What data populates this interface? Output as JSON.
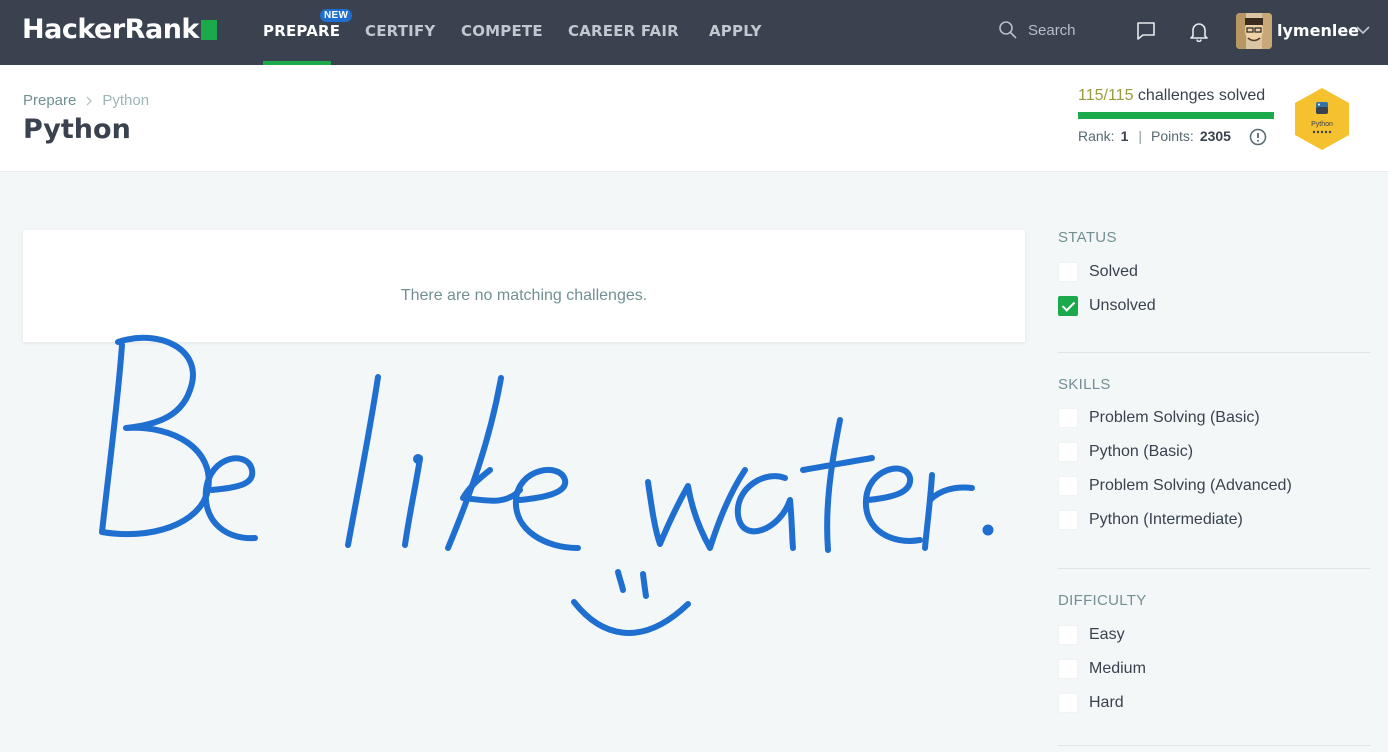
{
  "nav": {
    "logo": "HackerRank",
    "items": [
      {
        "label": "PREPARE",
        "active": true,
        "badge": "NEW"
      },
      {
        "label": "CERTIFY"
      },
      {
        "label": "COMPETE"
      },
      {
        "label": "CAREER FAIR"
      },
      {
        "label": "APPLY"
      }
    ],
    "search_placeholder": "Search",
    "username": "lymenlee"
  },
  "header": {
    "breadcrumb": [
      "Prepare",
      "Python"
    ],
    "title": "Python",
    "progress": {
      "solved_text": "115/115",
      "suffix": " challenges solved",
      "fraction": 1.0
    },
    "rank_label": "Rank:",
    "rank_value": "1",
    "points_label": "Points:",
    "points_value": "2305",
    "badge_label": "Python"
  },
  "main": {
    "empty_message": "There are no matching challenges."
  },
  "annotation": {
    "handwritten_text": "Be like water."
  },
  "filters": {
    "status": {
      "heading": "STATUS",
      "options": [
        {
          "label": "Solved",
          "checked": false
        },
        {
          "label": "Unsolved",
          "checked": true
        }
      ]
    },
    "skills": {
      "heading": "SKILLS",
      "options": [
        {
          "label": "Problem Solving (Basic)",
          "checked": false
        },
        {
          "label": "Python (Basic)",
          "checked": false
        },
        {
          "label": "Problem Solving (Advanced)",
          "checked": false
        },
        {
          "label": "Python (Intermediate)",
          "checked": false
        }
      ]
    },
    "difficulty": {
      "heading": "DIFFICULTY",
      "options": [
        {
          "label": "Easy",
          "checked": false
        },
        {
          "label": "Medium",
          "checked": false
        },
        {
          "label": "Hard",
          "checked": false
        }
      ]
    }
  },
  "colors": {
    "nav_bg": "#39424e",
    "accent_green": "#1ba94c",
    "badge_blue": "#1f6fd0",
    "ink_blue": "#1f6fd0",
    "hex_badge": "#f5c12e"
  }
}
